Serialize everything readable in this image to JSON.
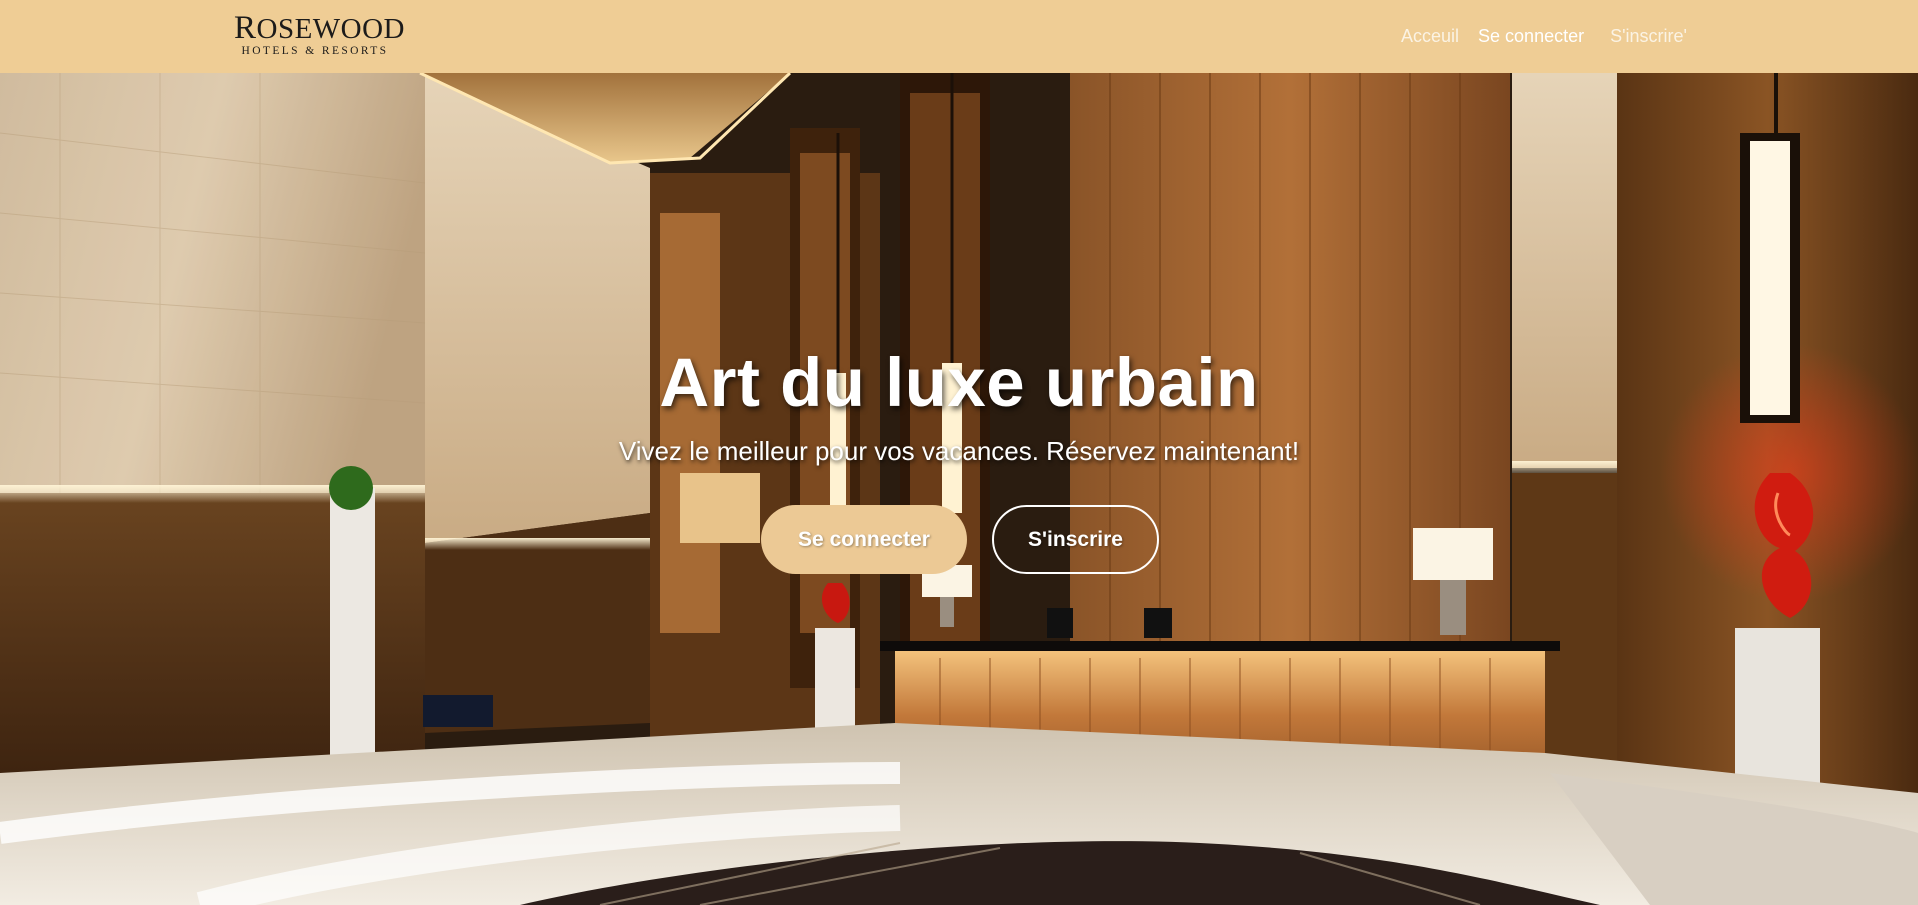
{
  "brand": {
    "name": "Rosewood",
    "tagline": "Hotels & Resorts"
  },
  "nav": {
    "items": [
      {
        "label": "Acceuil"
      },
      {
        "label": "Se connecter"
      },
      {
        "label": "S'inscrire'"
      }
    ]
  },
  "hero": {
    "title": "Art du luxe urbain",
    "subtitle": "Vivez le meilleur pour vos vacances. Réservez maintenant!",
    "primary_button": "Se connecter",
    "secondary_button": "S'inscrire",
    "background": "hotel-lobby-image"
  },
  "colors": {
    "navbar": "#efcd95",
    "button_primary": "#ecc995",
    "text_light": "#ffffff"
  }
}
